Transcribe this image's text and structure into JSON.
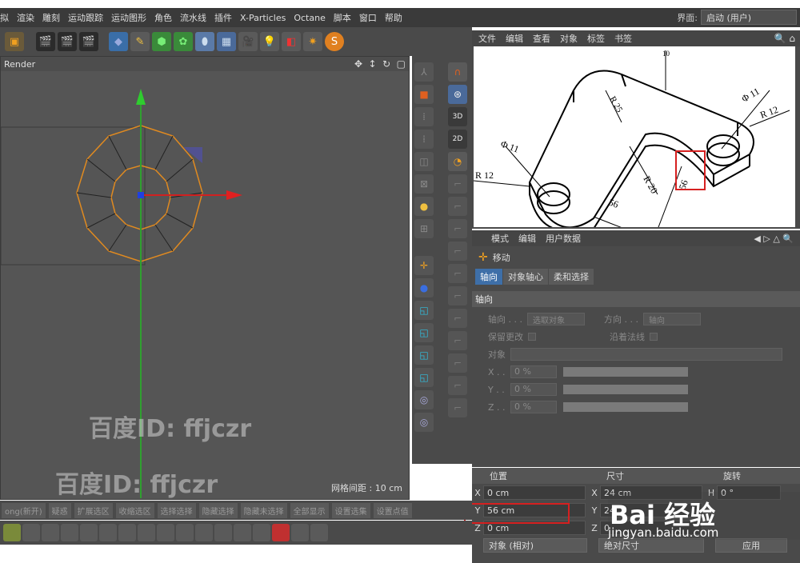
{
  "menu": {
    "items": [
      "拟",
      "渲染",
      "雕刻",
      "运动跟踪",
      "运动图形",
      "角色",
      "流水线",
      "插件",
      "X-Particles",
      "Octane",
      "脚本",
      "窗口",
      "帮助"
    ],
    "layout_label": "界面:",
    "layout_value": "启动 (用户)"
  },
  "viewport": {
    "title": "Render",
    "grid_info": "网格间距 : 10 cm",
    "watermark1": "百度ID: ffjczr",
    "watermark2": "百度ID: ffjczr"
  },
  "object_manager": {
    "menu": [
      "文件",
      "编辑",
      "查看",
      "对象",
      "标签",
      "书签"
    ]
  },
  "drawing": {
    "labels": {
      "top_width": "10",
      "r25": "R 25",
      "phi_right": "Φ 11",
      "r12_right": "R 12",
      "phi_left": "Φ 11",
      "r12_left": "R 12",
      "r20": "R 20",
      "len56_vertical": "56",
      "len56_bottom": "56"
    }
  },
  "attributes": {
    "menu": [
      "模式",
      "编辑",
      "用户数据"
    ],
    "tool_name": "移动",
    "tabs": [
      "轴向",
      "对象轴心",
      "柔和选择"
    ],
    "section": "轴向",
    "rows": {
      "axis_label": "轴向 . . .",
      "axis_value": "选取对象",
      "direction_label": "方向 . . .",
      "direction_value": "轴向",
      "keep_changes": "保留更改",
      "along_normal": "沿着法线",
      "object_label": "对象",
      "x_label": "X . .",
      "x_value": "0 %",
      "y_label": "Y . .",
      "y_value": "0 %",
      "z_label": "Z . .",
      "z_value": "0 %"
    }
  },
  "coordinates": {
    "head_position": "位置",
    "head_size": "尺寸",
    "head_rotation": "旋转",
    "x_pos": "0 cm",
    "y_pos": "56 cm",
    "z_pos": "0 cm",
    "x_size": "24 cm",
    "y_size": "24",
    "z_size": "0",
    "h_rot": "0 °",
    "mode_value": "对象 (相对)",
    "size_mode": "绝对尺寸",
    "apply": "应用"
  },
  "bottombar": [
    "ong(新开)",
    "疑惑",
    "扩展选区",
    "收缩选区",
    "选择选择",
    "隐藏选择",
    "隐藏未选择",
    "全部显示",
    "设置选集",
    "设置点值"
  ],
  "watermark_brand": "Bai 经验",
  "watermark_url": "jingyan.baidu.com",
  "colors": {
    "accent": "#3e6fa8",
    "highlight": "#d62020",
    "spline": "#e08a20"
  }
}
